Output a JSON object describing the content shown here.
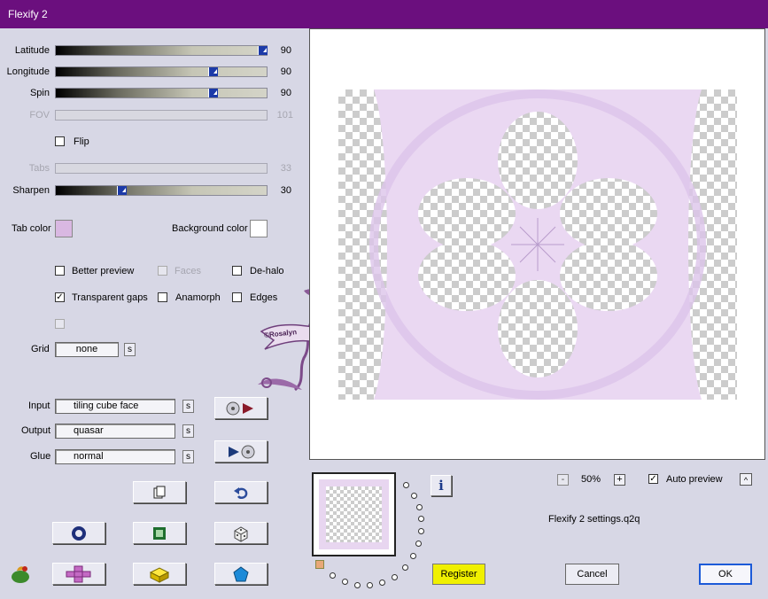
{
  "window": {
    "title": "Flexify 2"
  },
  "sliders": [
    {
      "label": "Latitude",
      "value": "90",
      "enabled": true,
      "level": 0.98
    },
    {
      "label": "Longitude",
      "value": "90",
      "enabled": true,
      "level": 0.75
    },
    {
      "label": "Spin",
      "value": "90",
      "enabled": true,
      "level": 0.75
    },
    {
      "label": "FOV",
      "value": "101",
      "enabled": false
    },
    {
      "label": "Tabs",
      "value": "33",
      "enabled": false
    },
    {
      "label": "Sharpen",
      "value": "30",
      "enabled": true,
      "level": 0.31
    }
  ],
  "flip": {
    "label": "Flip",
    "checked": false
  },
  "colors": {
    "tab_color_label": "Tab color",
    "tab_color": "#d9b8e2",
    "background_color_label": "Background color",
    "background_color": "#ffffff"
  },
  "options": {
    "better_preview": "Better preview",
    "faces": "Faces",
    "de_halo": "De-halo",
    "transparent_gaps": "Transparent gaps",
    "anamorph": "Anamorph",
    "edges": "Edges"
  },
  "grid": {
    "label": "Grid",
    "value": "none",
    "s_button": "s"
  },
  "io": {
    "input_label": "Input",
    "input_value": "tiling cube face",
    "output_label": "Output",
    "output_value": "quasar",
    "glue_label": "Glue",
    "glue_value": "normal",
    "s_button": "s"
  },
  "preview": {
    "zoom_minus": "-",
    "zoom_value": "50%",
    "zoom_plus": "+",
    "auto_preview_label": "Auto preview",
    "auto_preview_checked": true,
    "settings_file": "Flexify 2 settings.q2q",
    "info_icon": "i",
    "collapse_icon": "^"
  },
  "buttons": {
    "register": "Register",
    "cancel": "Cancel",
    "ok": "OK"
  },
  "watermark": {
    "text": "©Rosalyn"
  },
  "accent": {
    "title_bar": "#6b0f7e",
    "register": "#f0f000",
    "thumb": "#1c3aa8"
  }
}
